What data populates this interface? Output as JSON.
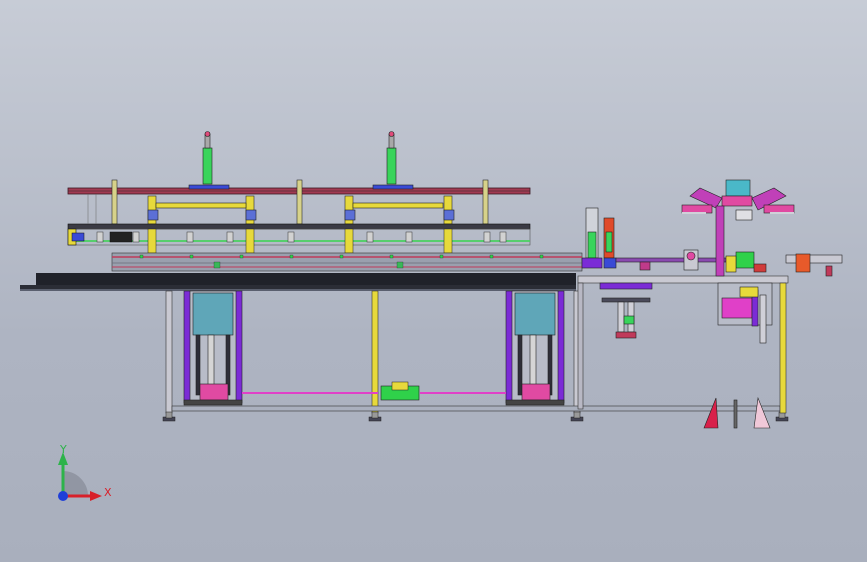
{
  "viewport": {
    "background_top": "#c7ccd6",
    "background_bottom": "#a9afbd"
  },
  "triad": {
    "y_label": "Y",
    "x_label": "X",
    "y_color": "#2db34a",
    "x_color": "#d8202a",
    "z_color": "#1f3fd8"
  },
  "model": {
    "frame_color": "#8b95a6",
    "accent_colors": [
      "#7b2bd6",
      "#e0d52b",
      "#2fd14a",
      "#e63a7a",
      "#5fa6b8",
      "#d03b3b"
    ]
  }
}
